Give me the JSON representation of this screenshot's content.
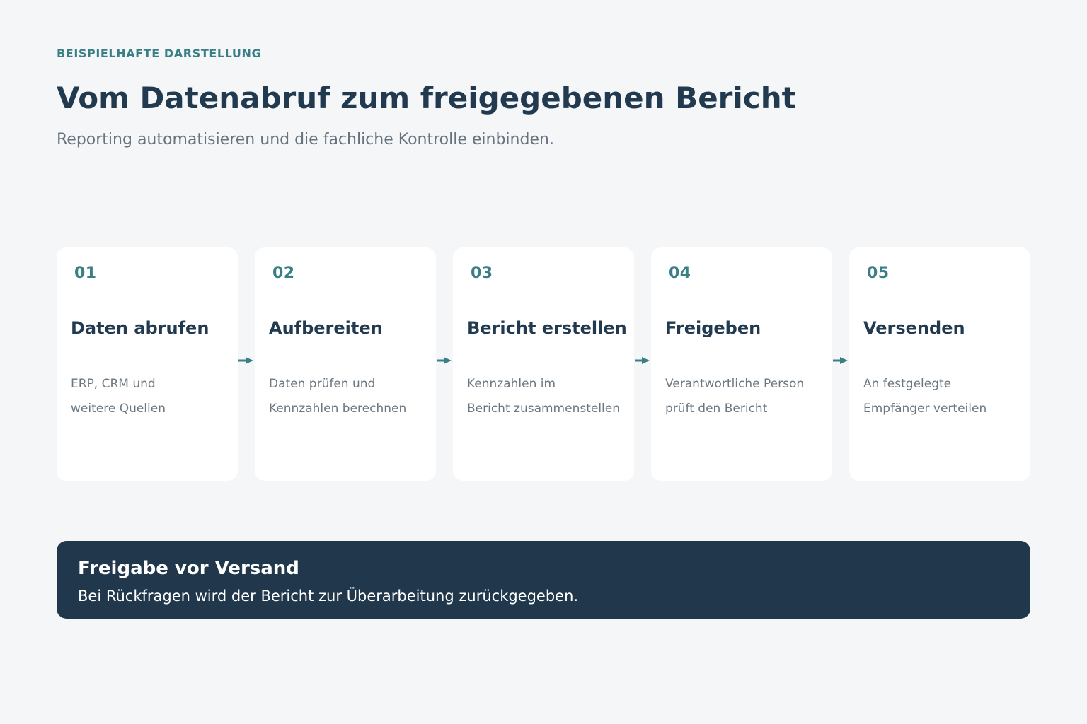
{
  "header": {
    "eyebrow": "BEISPIELHAFTE DARSTELLUNG",
    "title": "Vom Datenabruf zum freigegebenen Bericht",
    "subtitle": "Reporting automatisieren und die fachliche Kontrolle einbinden."
  },
  "steps": [
    {
      "number": "01",
      "title": "Daten abrufen",
      "desc_line1": "ERP, CRM und",
      "desc_line2": "weitere Quellen"
    },
    {
      "number": "02",
      "title": "Aufbereiten",
      "desc_line1": "Daten prüfen und",
      "desc_line2": "Kennzahlen berechnen"
    },
    {
      "number": "03",
      "title": "Bericht erstellen",
      "desc_line1": "Kennzahlen im",
      "desc_line2": "Bericht zusammenstellen"
    },
    {
      "number": "04",
      "title": "Freigeben",
      "desc_line1": "Verantwortliche Person",
      "desc_line2": "prüft den Bericht"
    },
    {
      "number": "05",
      "title": "Versenden",
      "desc_line1": "An festgelegte",
      "desc_line2": "Empfänger verteilen"
    }
  ],
  "banner": {
    "title": "Freigabe vor Versand",
    "text": "Bei Rückfragen wird der Bericht zur Überarbeitung zurückgegeben."
  },
  "colors": {
    "accent": "#3a7f86",
    "dark": "#213a4f",
    "muted": "#66737e",
    "card": "#ffffff",
    "background": "#f5f6f8",
    "banner": "#21374b"
  },
  "icons": {
    "connector": "arrow-right-icon"
  }
}
